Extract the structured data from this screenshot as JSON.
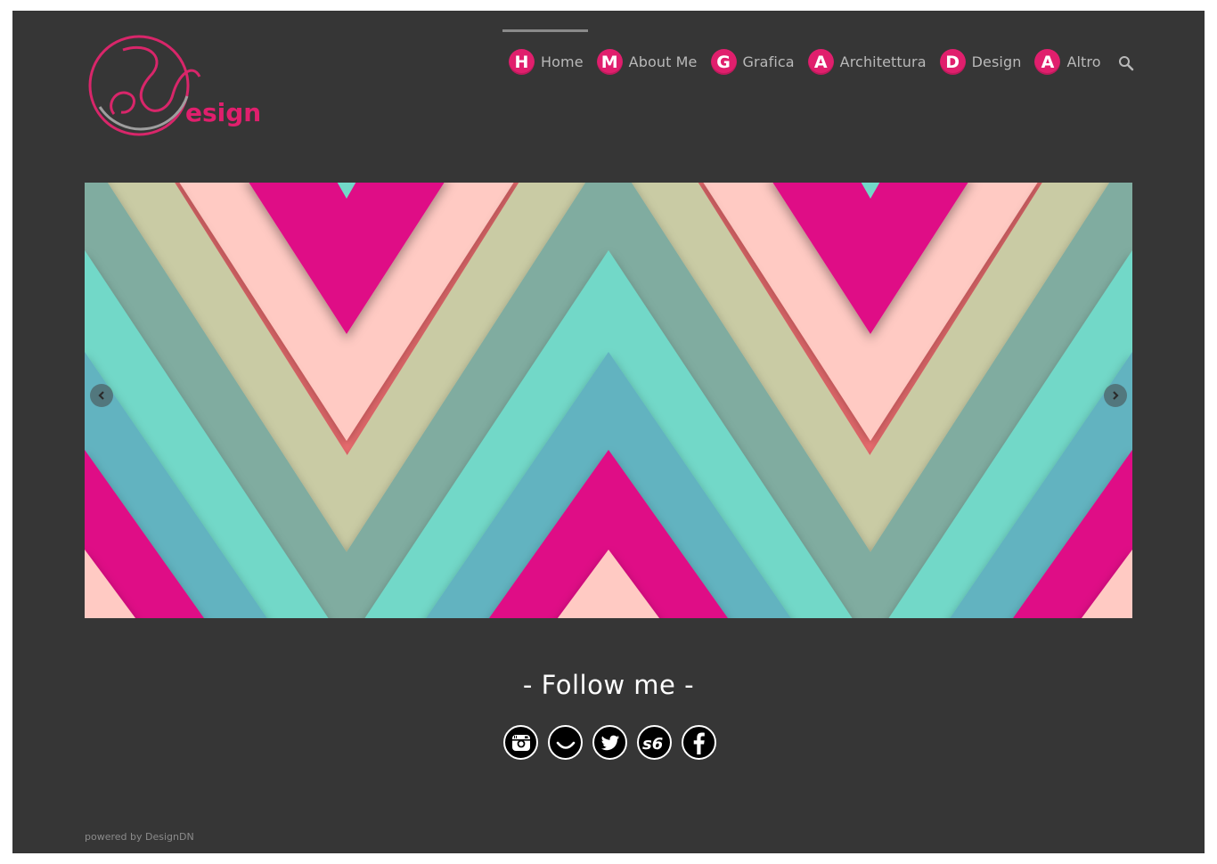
{
  "brand": {
    "logo_text": "Design",
    "accent_color": "#e01f6d"
  },
  "nav": {
    "items": [
      {
        "badge": "H",
        "label": "Home"
      },
      {
        "badge": "M",
        "label": "About Me"
      },
      {
        "badge": "G",
        "label": "Grafica"
      },
      {
        "badge": "A",
        "label": "Architettura"
      },
      {
        "badge": "D",
        "label": "Design"
      },
      {
        "badge": "A",
        "label": "Altro"
      }
    ],
    "search_icon": "search-icon",
    "active_item": "Home"
  },
  "slider": {
    "prev_icon": "chevron-left-icon",
    "next_icon": "chevron-right-icon",
    "palette": [
      "#df0c86",
      "#ff7679",
      "#ffcac3",
      "#c9cba4",
      "#80aca0",
      "#72d8c8",
      "#62b3c0"
    ]
  },
  "follow": {
    "title": "- Follow me -",
    "icons": [
      "instagram-icon",
      "smile-icon",
      "twitter-icon",
      "s6-icon",
      "facebook-icon"
    ]
  },
  "footer": {
    "text": "powered by DesignDN"
  }
}
